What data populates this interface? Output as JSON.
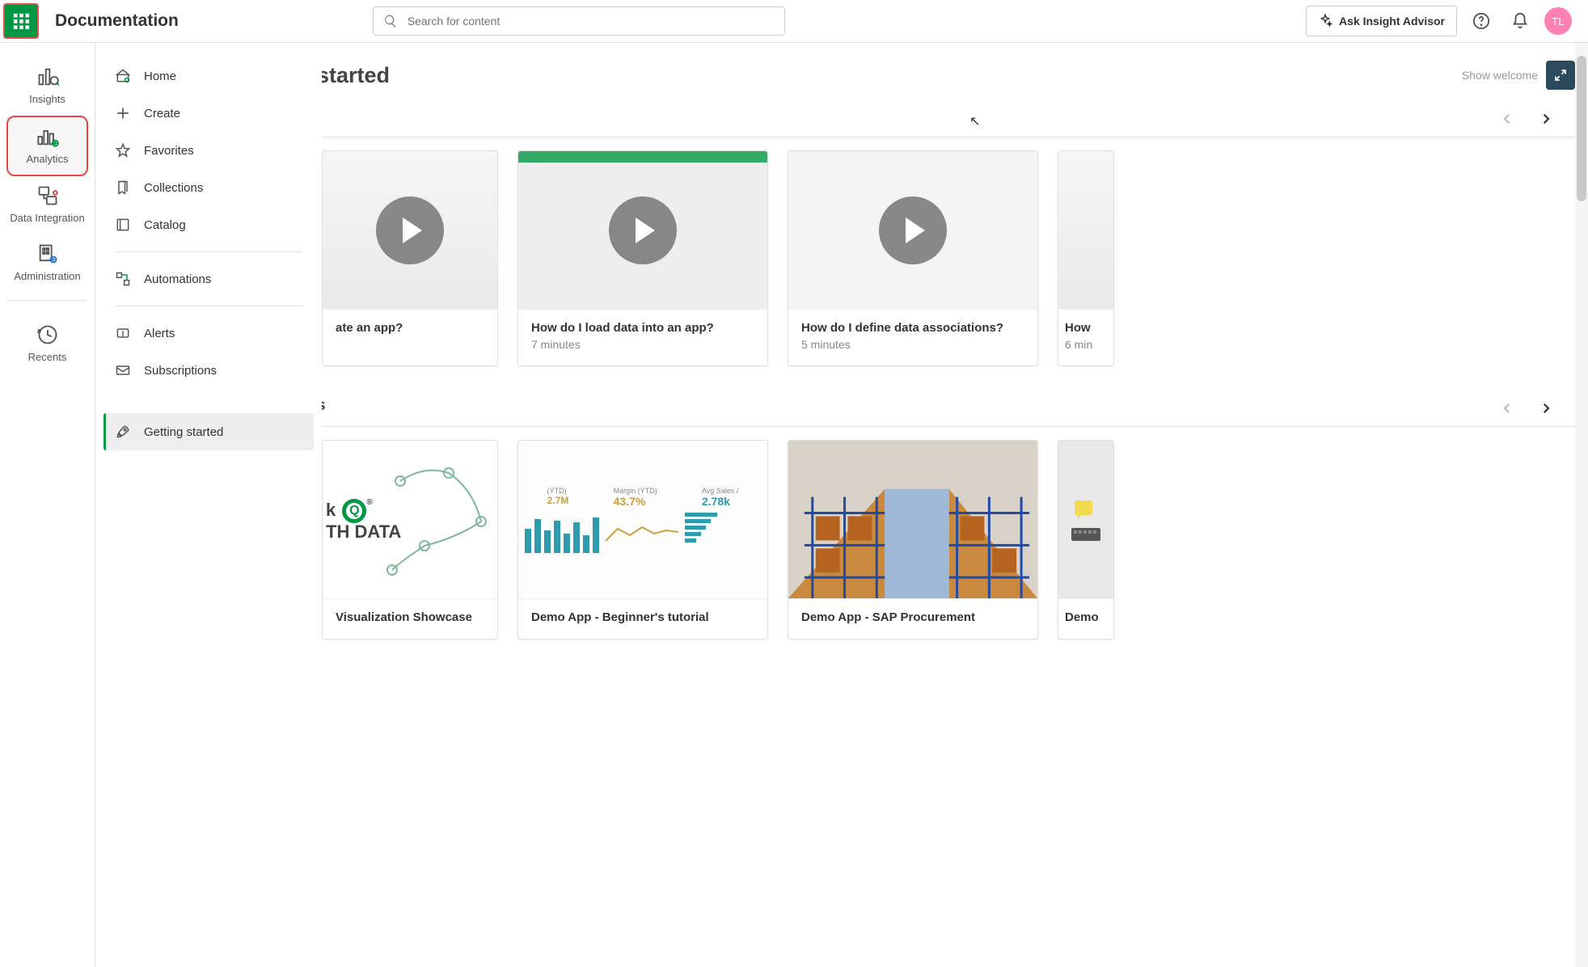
{
  "header": {
    "title": "Documentation",
    "search_placeholder": "Search for content",
    "ask_advisor": "Ask Insight Advisor",
    "avatar_initials": "TL"
  },
  "primary_nav": {
    "items": [
      {
        "label": "Insights"
      },
      {
        "label": "Analytics"
      },
      {
        "label": "Data Integration"
      },
      {
        "label": "Administration"
      },
      {
        "label": "Recents"
      }
    ]
  },
  "secondary_nav": {
    "items": [
      {
        "label": "Home"
      },
      {
        "label": "Create"
      },
      {
        "label": "Favorites"
      },
      {
        "label": "Collections"
      },
      {
        "label": "Catalog"
      },
      {
        "label": "Automations"
      },
      {
        "label": "Alerts"
      },
      {
        "label": "Subscriptions"
      },
      {
        "label": "Getting started"
      }
    ]
  },
  "page": {
    "title_partial": "started",
    "show_welcome": "Show welcome"
  },
  "videos": [
    {
      "title_partial": "ate an app?",
      "duration": ""
    },
    {
      "title": "How do I load data into an app?",
      "duration": "7 minutes"
    },
    {
      "title": "How do I define data associations?",
      "duration": "5 minutes"
    },
    {
      "title_partial": "How ",
      "duration_partial": "6 min"
    }
  ],
  "section2": {
    "title_partial": "s"
  },
  "demos": [
    {
      "title_partial": "Visualization Showcase"
    },
    {
      "title": "Demo App - Beginner's tutorial"
    },
    {
      "title": "Demo App - SAP Procurement"
    },
    {
      "title_partial": "Demo"
    }
  ],
  "demo_thumb_1": {
    "brand_line1": "k",
    "brand_line2": "TH DATA",
    "brand_suffix": "®"
  },
  "demo_thumb_2": {
    "margin_label": "Margin (YTD)",
    "margin_value": "43.7%",
    "avg_label": "Avg Sales /",
    "avg_value": "2.78k",
    "kpi_label": "(YTD)",
    "kpi_value": "2.7M"
  }
}
